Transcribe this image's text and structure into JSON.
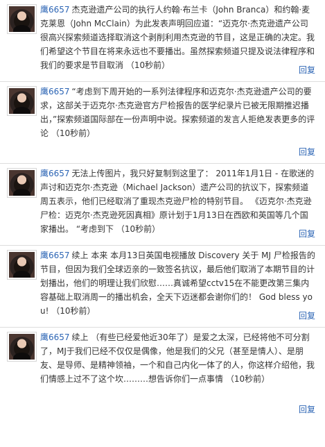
{
  "comments": [
    {
      "user": "鹰6657",
      "text": "杰克逊遗产公司的执行人约翰·布兰卡（John Branca）和约翰·麦克莱恩（John McClain）为此发表声明回应道：“迈克尔·杰克逊遗产公司很高兴探索频道选择取消这个剥削利用杰克逊的节目，这是正确的决定。我们希望这个节目在将来永远也不要播出。虽然探索频道只提及说法律程序和我们的要求是节目取消 （10秒前）",
      "reply": "回复"
    },
    {
      "user": "鹰6657",
      "text": "“考虑到下周开始的一系列法律程序和迈克尔·杰克逊遗产公司的要求，这部关于迈克尔·杰克逊官方尸检报告的医学纪录片已被无限期推迟播出，”探索频道国际部在一份声明中说。探索频道的发言人拒绝发表更多的评论 （10秒前）",
      "reply": "回复"
    },
    {
      "user": "鹰6657",
      "text": "无法上传图片，我只好复制到这里了： 2011年1月1日 - 在歌迷的声讨和迈克尔·杰克逊（Michael Jackson）遗产公司的抗议下，探索频道周五表示，他们已经取消了重现杰克逊尸检的特别节目。 《迈克尔·杰克逊尸检：迈克尔·杰克逊死因真相》原计划于1月13日在西欧和英国等几个国家播出。 “考虑到下 （10秒前）",
      "reply": "回复"
    },
    {
      "user": "鹰6657",
      "text": "续上 本来 本月13日英国电视播放 Discovery 关于 MJ 尸检报告的节目，但因为我们全球迈亲的一致签名抗议，最后他们取消了本期节目的计划播出，他们的明理让我们欣慰……真诚希望cctv15在不能更改第三集内容基础上取消周一的播出机会，全天下迈迷都会谢你们的！ God bless you! （10秒前）",
      "reply": "回复"
    },
    {
      "user": "鹰6657",
      "text": "续上 （有些已经爱他近30年了）是爱之太深，已经将他不可分割了，MJ于我们已经不仅仅是偶像，他是我们的父兄（甚至是情人）、是朋友、是导师、是精神领袖，一个和自己内化一体了的人，你这样介绍他，我们情感上过不了这个坎………想告诉你们一点事情 （10秒前）",
      "reply": "回复"
    }
  ]
}
